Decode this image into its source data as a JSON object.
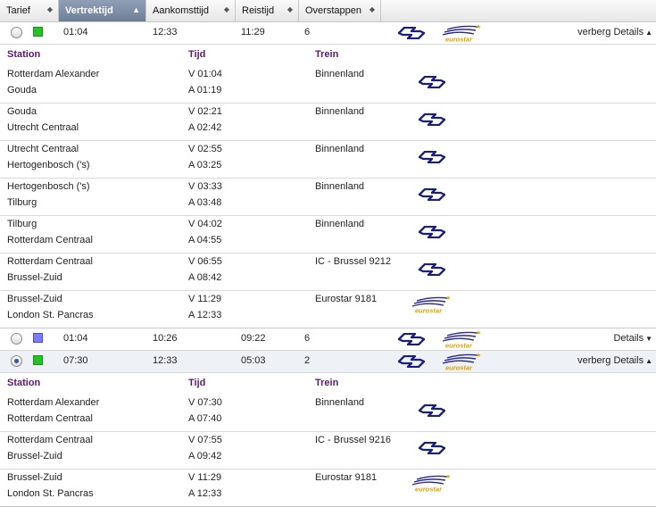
{
  "columns": [
    {
      "label": "Tarief"
    },
    {
      "label": "Vertrektijd"
    },
    {
      "label": "Aankomsttijd"
    },
    {
      "label": "Reistijd"
    },
    {
      "label": "Overstappen"
    }
  ],
  "details_header": {
    "station": "Station",
    "tijd": "Tijd",
    "trein": "Trein"
  },
  "trips": [
    {
      "selected": false,
      "tariff_color": "green",
      "departure": "01:04",
      "arrival": "12:33",
      "duration": "11:29",
      "transfers": "6",
      "details_label": "verberg Details",
      "expanded": true,
      "legs": [
        {
          "from": "Rotterdam Alexander",
          "to": "Gouda",
          "dep": "V 01:04",
          "arr": "A 01:19",
          "train": "Binnenland",
          "carrier": "ns"
        },
        {
          "from": "Gouda",
          "to": "Utrecht Centraal",
          "dep": "V 02:21",
          "arr": "A 02:42",
          "train": "Binnenland",
          "carrier": "ns"
        },
        {
          "from": "Utrecht Centraal",
          "to": "Hertogenbosch ('s)",
          "dep": "V 02:55",
          "arr": "A 03:25",
          "train": "Binnenland",
          "carrier": "ns"
        },
        {
          "from": "Hertogenbosch ('s)",
          "to": "Tilburg",
          "dep": "V 03:33",
          "arr": "A 03:48",
          "train": "Binnenland",
          "carrier": "ns"
        },
        {
          "from": "Tilburg",
          "to": "Rotterdam Centraal",
          "dep": "V 04:02",
          "arr": "A 04:55",
          "train": "Binnenland",
          "carrier": "ns"
        },
        {
          "from": "Rotterdam Centraal",
          "to": "Brussel-Zuid",
          "dep": "V 06:55",
          "arr": "A 08:42",
          "train": "IC - Brussel 9212",
          "carrier": "ns"
        },
        {
          "from": "Brussel-Zuid",
          "to": "London St. Pancras",
          "dep": "V 11:29",
          "arr": "A 12:33",
          "train": "Eurostar 9181",
          "carrier": "eurostar"
        }
      ]
    },
    {
      "selected": false,
      "tariff_color": "blue",
      "departure": "01:04",
      "arrival": "10:26",
      "duration": "09:22",
      "transfers": "6",
      "details_label": "Details",
      "expanded": false,
      "legs": []
    },
    {
      "selected": true,
      "tariff_color": "green",
      "departure": "07:30",
      "arrival": "12:33",
      "duration": "05:03",
      "transfers": "2",
      "details_label": "verberg Details",
      "expanded": true,
      "legs": [
        {
          "from": "Rotterdam Alexander",
          "to": "Rotterdam Centraal",
          "dep": "V 07:30",
          "arr": "A 07:40",
          "train": "Binnenland",
          "carrier": "ns"
        },
        {
          "from": "Rotterdam Centraal",
          "to": "Brussel-Zuid",
          "dep": "V 07:55",
          "arr": "A 09:42",
          "train": "IC - Brussel 9216",
          "carrier": "ns"
        },
        {
          "from": "Brussel-Zuid",
          "to": "London St. Pancras",
          "dep": "V 11:29",
          "arr": "A 12:33",
          "train": "Eurostar 9181",
          "carrier": "eurostar"
        }
      ]
    }
  ],
  "logos": {
    "eurostar_text": "eurostar"
  },
  "colors": {
    "ns_logo": "#1a1f7a",
    "eurostar_text": "#d9a300",
    "header_label": "#5b1a6e",
    "active_header": "#7a8ca6"
  }
}
